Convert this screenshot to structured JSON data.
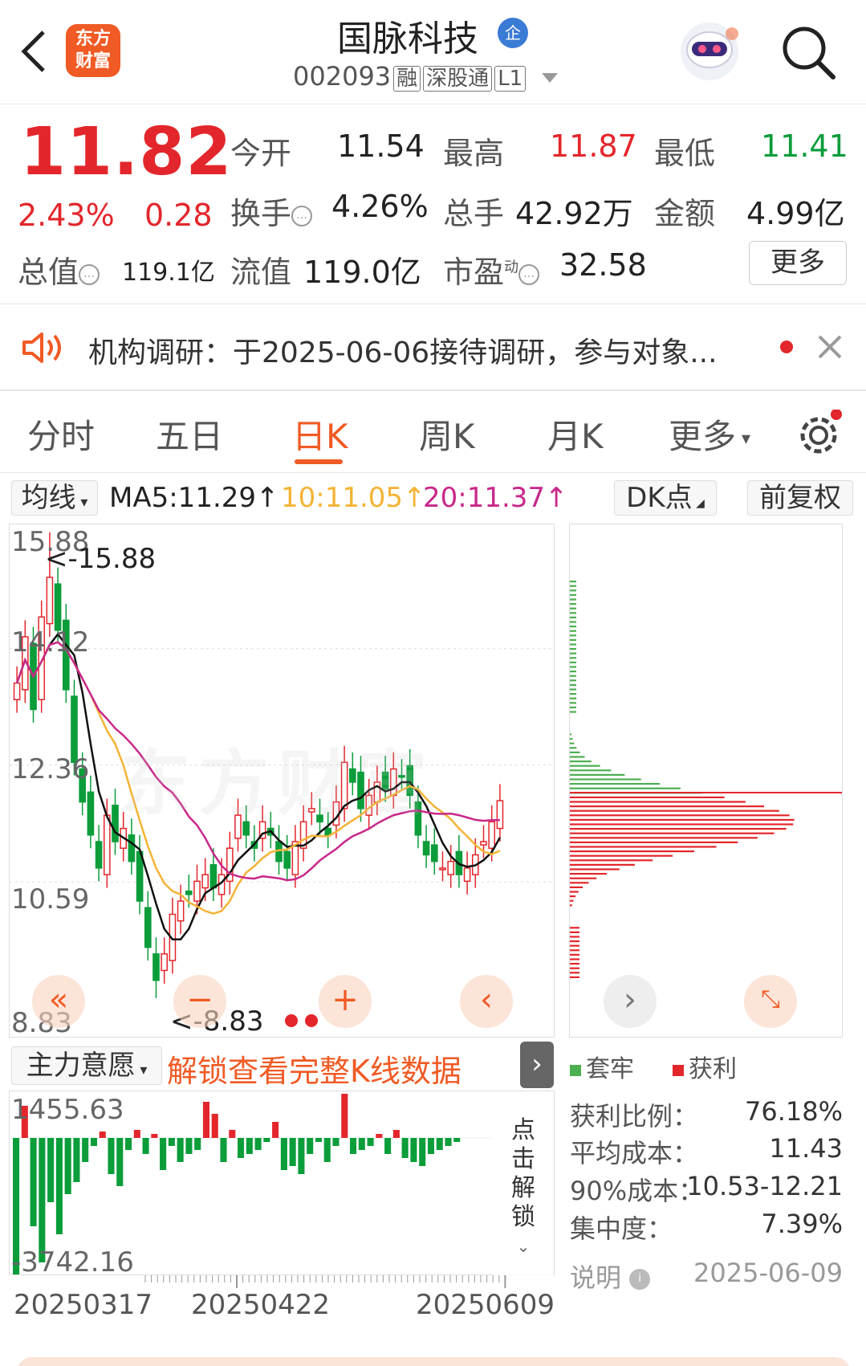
{
  "header": {
    "logo_text": "东方\n财富",
    "stock_name": "国脉科技",
    "badge": "企",
    "code": "002093",
    "tags": [
      "融",
      "深股通",
      "L1"
    ]
  },
  "quote": {
    "price": "11.82",
    "change_pct": "2.43%",
    "change": "0.28",
    "open_label": "今开",
    "open": "11.54",
    "high_label": "最高",
    "high": "11.87",
    "low_label": "最低",
    "low": "11.41",
    "turnover_label": "换手",
    "turnover": "4.26%",
    "volume_label": "总手",
    "volume": "42.92万",
    "amount_label": "金额",
    "amount": "4.99亿",
    "total_mv_label": "总值",
    "total_mv": "119.1亿",
    "float_mv_label": "流值",
    "float_mv": "119.0亿",
    "pe_label": "市盈",
    "pe_sup": "动",
    "pe": "32.58",
    "more_label": "更多"
  },
  "notice": {
    "text": "机构调研：于2025-06-06接待调研，参与对象..."
  },
  "tabs": [
    "分时",
    "五日",
    "日K",
    "周K",
    "月K",
    "更多"
  ],
  "ma_bar": {
    "indicator": "均线",
    "ma5": "MA5:11.29↑",
    "ma10": "10:11.05↑",
    "ma20": "20:11.37↑",
    "dk": "DK点",
    "adjust": "前复权"
  },
  "kline": {
    "y_labels": [
      "15.88",
      "14.12",
      "12.36",
      "10.59",
      "8.83"
    ],
    "max_marker": "<-15.88",
    "min_marker": "<-8.83",
    "watermark": "东方财富"
  },
  "sub_chart": {
    "indicator": "主力意愿",
    "unlock_text": "解锁查看完整K线数据",
    "top_label": "1455.63",
    "bottom_label": "-3742.16",
    "click_unlock": "点击解锁"
  },
  "dates": [
    "20250317",
    "20250422",
    "20250609"
  ],
  "chips": {
    "legend_loss": "套牢",
    "legend_profit": "获利",
    "rows": [
      {
        "label": "获利比例：",
        "value": "76.18%"
      },
      {
        "label": "平均成本：",
        "value": "11.43"
      },
      {
        "label": "90%成本：",
        "value": "10.53-12.21"
      },
      {
        "label": "集中度：",
        "value": "7.39%"
      }
    ],
    "note_label": "说明",
    "date": "2025-06-09"
  },
  "colors": {
    "up": "#e3262b",
    "down": "#0a9d3a",
    "accent": "#f05a24",
    "ma5": "#111111",
    "ma10": "#f5b335",
    "ma20": "#c8288a"
  }
}
